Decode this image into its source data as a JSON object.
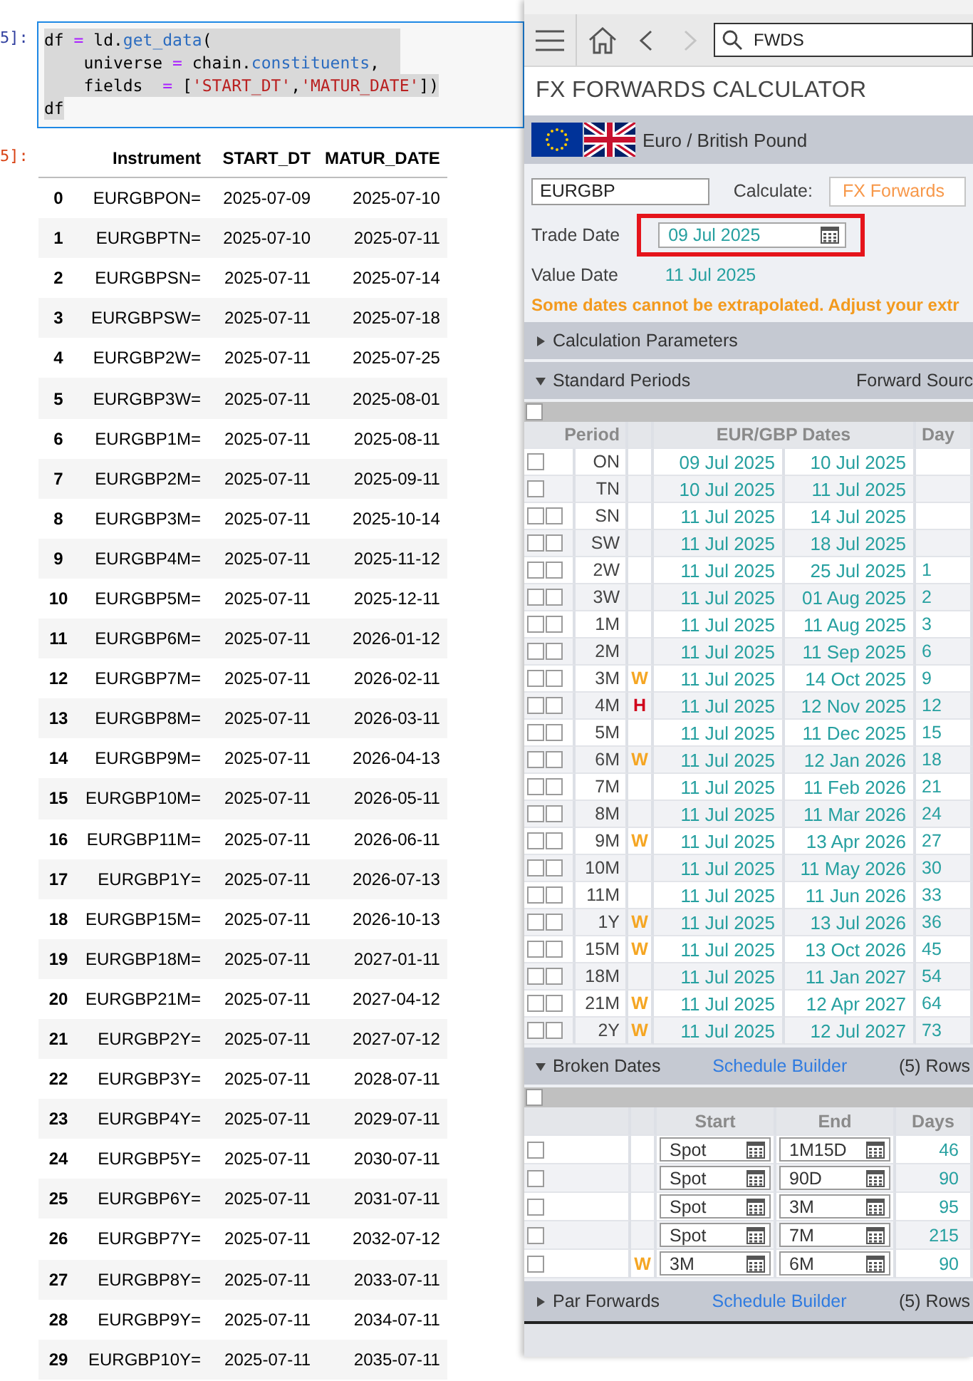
{
  "notebook": {
    "input_prompt": "5]:",
    "code_lines": [
      [
        {
          "text": "df ",
          "kind": "name"
        },
        {
          "text": "=",
          "kind": "op"
        },
        {
          "text": " ld.",
          "kind": "name"
        },
        {
          "text": "get_data",
          "kind": "attr"
        },
        {
          "text": "(",
          "kind": "name"
        }
      ],
      [
        {
          "text": "    universe ",
          "kind": "name"
        },
        {
          "text": "=",
          "kind": "op"
        },
        {
          "text": " chain.",
          "kind": "name"
        },
        {
          "text": "constituents",
          "kind": "attr"
        },
        {
          "text": ",",
          "kind": "name"
        }
      ],
      [
        {
          "text": "    fields  ",
          "kind": "name"
        },
        {
          "text": "=",
          "kind": "op"
        },
        {
          "text": " [",
          "kind": "name"
        },
        {
          "text": "'START_DT'",
          "kind": "str"
        },
        {
          "text": ",",
          "kind": "name"
        },
        {
          "text": "'MATUR_DATE'",
          "kind": "str"
        },
        {
          "text": "])",
          "kind": "name"
        }
      ],
      [
        {
          "text": "df",
          "kind": "name"
        }
      ]
    ],
    "output_prompt": "5]:",
    "table": {
      "columns": [
        "Instrument",
        "START_DT",
        "MATUR_DATE"
      ],
      "rows": [
        {
          "index": "0",
          "cells": [
            "EURGBPON=",
            "2025-07-09",
            "2025-07-10"
          ]
        },
        {
          "index": "1",
          "cells": [
            "EURGBPTN=",
            "2025-07-10",
            "2025-07-11"
          ]
        },
        {
          "index": "2",
          "cells": [
            "EURGBPSN=",
            "2025-07-11",
            "2025-07-14"
          ]
        },
        {
          "index": "3",
          "cells": [
            "EURGBPSW=",
            "2025-07-11",
            "2025-07-18"
          ]
        },
        {
          "index": "4",
          "cells": [
            "EURGBP2W=",
            "2025-07-11",
            "2025-07-25"
          ]
        },
        {
          "index": "5",
          "cells": [
            "EURGBP3W=",
            "2025-07-11",
            "2025-08-01"
          ]
        },
        {
          "index": "6",
          "cells": [
            "EURGBP1M=",
            "2025-07-11",
            "2025-08-11"
          ]
        },
        {
          "index": "7",
          "cells": [
            "EURGBP2M=",
            "2025-07-11",
            "2025-09-11"
          ]
        },
        {
          "index": "8",
          "cells": [
            "EURGBP3M=",
            "2025-07-11",
            "2025-10-14"
          ]
        },
        {
          "index": "9",
          "cells": [
            "EURGBP4M=",
            "2025-07-11",
            "2025-11-12"
          ]
        },
        {
          "index": "10",
          "cells": [
            "EURGBP5M=",
            "2025-07-11",
            "2025-12-11"
          ]
        },
        {
          "index": "11",
          "cells": [
            "EURGBP6M=",
            "2025-07-11",
            "2026-01-12"
          ]
        },
        {
          "index": "12",
          "cells": [
            "EURGBP7M=",
            "2025-07-11",
            "2026-02-11"
          ]
        },
        {
          "index": "13",
          "cells": [
            "EURGBP8M=",
            "2025-07-11",
            "2026-03-11"
          ]
        },
        {
          "index": "14",
          "cells": [
            "EURGBP9M=",
            "2025-07-11",
            "2026-04-13"
          ]
        },
        {
          "index": "15",
          "cells": [
            "EURGBP10M=",
            "2025-07-11",
            "2026-05-11"
          ]
        },
        {
          "index": "16",
          "cells": [
            "EURGBP11M=",
            "2025-07-11",
            "2026-06-11"
          ]
        },
        {
          "index": "17",
          "cells": [
            "EURGBP1Y=",
            "2025-07-11",
            "2026-07-13"
          ]
        },
        {
          "index": "18",
          "cells": [
            "EURGBP15M=",
            "2025-07-11",
            "2026-10-13"
          ]
        },
        {
          "index": "19",
          "cells": [
            "EURGBP18M=",
            "2025-07-11",
            "2027-01-11"
          ]
        },
        {
          "index": "20",
          "cells": [
            "EURGBP21M=",
            "2025-07-11",
            "2027-04-12"
          ]
        },
        {
          "index": "21",
          "cells": [
            "EURGBP2Y=",
            "2025-07-11",
            "2027-07-12"
          ]
        },
        {
          "index": "22",
          "cells": [
            "EURGBP3Y=",
            "2025-07-11",
            "2028-07-11"
          ]
        },
        {
          "index": "23",
          "cells": [
            "EURGBP4Y=",
            "2025-07-11",
            "2029-07-11"
          ]
        },
        {
          "index": "24",
          "cells": [
            "EURGBP5Y=",
            "2025-07-11",
            "2030-07-11"
          ]
        },
        {
          "index": "25",
          "cells": [
            "EURGBP6Y=",
            "2025-07-11",
            "2031-07-11"
          ]
        },
        {
          "index": "26",
          "cells": [
            "EURGBP7Y=",
            "2025-07-11",
            "2032-07-12"
          ]
        },
        {
          "index": "27",
          "cells": [
            "EURGBP8Y=",
            "2025-07-11",
            "2033-07-11"
          ]
        },
        {
          "index": "28",
          "cells": [
            "EURGBP9Y=",
            "2025-07-11",
            "2034-07-11"
          ]
        },
        {
          "index": "29",
          "cells": [
            "EURGBP10Y=",
            "2025-07-11",
            "2035-07-11"
          ]
        }
      ]
    }
  },
  "calculator": {
    "toolbar": {
      "back_button": {
        "disabled": false
      },
      "forward_button": {
        "disabled": true
      },
      "search": {
        "value": "FWDS"
      }
    },
    "title": "FX FORWARDS CALCULATOR",
    "currency_pair": "Euro / British Pound",
    "ric_field": {
      "value": "EURGBP"
    },
    "calculate_label": "Calculate:",
    "calculate_value": "FX Forwards",
    "trade_date": {
      "label": "Trade Date",
      "value": "09 Jul 2025",
      "highlighted": true
    },
    "value_date": {
      "label": "Value Date",
      "value": "11 Jul 2025"
    },
    "warning": "Some dates cannot be extrapolated. Adjust your extr",
    "calculation_parameters": {
      "title": "Calculation Parameters",
      "expanded": false
    },
    "standard_periods": {
      "title": "Standard Periods",
      "expanded": true,
      "source_label": "Forward Sourc",
      "select_all": {
        "checked": false
      },
      "columns": [
        "Period",
        "EUR/GBP Dates",
        "Day"
      ],
      "rows": [
        {
          "kind": "plain",
          "period": "ON",
          "checks": [
            false
          ],
          "start": "09 Jul 2025",
          "end": "10 Jul 2025"
        },
        {
          "kind": "plain",
          "period": "TN",
          "checks": [
            false
          ],
          "start": "10 Jul 2025",
          "end": "11 Jul 2025"
        },
        {
          "kind": "plain",
          "period": "SN",
          "checks": [
            false,
            false
          ],
          "start": "11 Jul 2025",
          "end": "14 Jul 2025"
        },
        {
          "kind": "plain",
          "period": "SW",
          "checks": [
            false,
            false
          ],
          "start": "11 Jul 2025",
          "end": "18 Jul 2025"
        },
        {
          "kind": "plain",
          "period": "2W",
          "checks": [
            false,
            false
          ],
          "start": "11 Jul 2025",
          "end": "25 Jul 2025",
          "days": "1"
        },
        {
          "kind": "plain",
          "period": "3W",
          "checks": [
            false,
            false
          ],
          "start": "11 Jul 2025",
          "end": "01 Aug 2025",
          "days": "2"
        },
        {
          "kind": "plain",
          "period": "1M",
          "checks": [
            false,
            false
          ],
          "start": "11 Jul 2025",
          "end": "11 Aug 2025",
          "days": "3"
        },
        {
          "kind": "plain",
          "period": "2M",
          "checks": [
            false,
            false
          ],
          "start": "11 Jul 2025",
          "end": "11 Sep 2025",
          "days": "6"
        },
        {
          "kind": "warning",
          "period": "3M",
          "checks": [
            false,
            false
          ],
          "flag": "W",
          "start": "11 Jul 2025",
          "end": "14 Oct 2025",
          "days": "9"
        },
        {
          "kind": "holiday",
          "period": "4M",
          "checks": [
            false,
            false
          ],
          "flag": "H",
          "start": "11 Jul 2025",
          "end": "12 Nov 2025",
          "days": "12"
        },
        {
          "kind": "plain",
          "period": "5M",
          "checks": [
            false,
            false
          ],
          "start": "11 Jul 2025",
          "end": "11 Dec 2025",
          "days": "15"
        },
        {
          "kind": "warning",
          "period": "6M",
          "checks": [
            false,
            false
          ],
          "flag": "W",
          "start": "11 Jul 2025",
          "end": "12 Jan 2026",
          "days": "18"
        },
        {
          "kind": "plain",
          "period": "7M",
          "checks": [
            false,
            false
          ],
          "start": "11 Jul 2025",
          "end": "11 Feb 2026",
          "days": "21"
        },
        {
          "kind": "plain",
          "period": "8M",
          "checks": [
            false,
            false
          ],
          "start": "11 Jul 2025",
          "end": "11 Mar 2026",
          "days": "24"
        },
        {
          "kind": "warning",
          "period": "9M",
          "checks": [
            false,
            false
          ],
          "flag": "W",
          "start": "11 Jul 2025",
          "end": "13 Apr 2026",
          "days": "27"
        },
        {
          "kind": "plain",
          "period": "10M",
          "checks": [
            false,
            false
          ],
          "start": "11 Jul 2025",
          "end": "11 May 2026",
          "days": "30"
        },
        {
          "kind": "plain",
          "period": "11M",
          "checks": [
            false,
            false
          ],
          "start": "11 Jul 2025",
          "end": "11 Jun 2026",
          "days": "33"
        },
        {
          "kind": "warning",
          "period": "1Y",
          "checks": [
            false,
            false
          ],
          "flag": "W",
          "start": "11 Jul 2025",
          "end": "13 Jul 2026",
          "days": "36"
        },
        {
          "kind": "warning",
          "period": "15M",
          "checks": [
            false,
            false
          ],
          "flag": "W",
          "start": "11 Jul 2025",
          "end": "13 Oct 2026",
          "days": "45"
        },
        {
          "kind": "plain",
          "period": "18M",
          "checks": [
            false,
            false
          ],
          "start": "11 Jul 2025",
          "end": "11 Jan 2027",
          "days": "54"
        },
        {
          "kind": "warning",
          "period": "21M",
          "checks": [
            false,
            false
          ],
          "flag": "W",
          "start": "11 Jul 2025",
          "end": "12 Apr 2027",
          "days": "64"
        },
        {
          "kind": "warning",
          "period": "2Y",
          "checks": [
            false,
            false
          ],
          "flag": "W",
          "start": "11 Jul 2025",
          "end": "12 Jul 2027",
          "days": "73"
        }
      ]
    },
    "broken_dates": {
      "title": "Broken Dates",
      "expanded": true,
      "link": "Schedule Builder",
      "count": "(5) Rows",
      "select_all": {
        "checked": false
      },
      "columns": [
        "Start",
        "End",
        "Days"
      ],
      "rows": [
        {
          "kind": "plain",
          "checked": false,
          "start": "Spot",
          "end": "1M15D",
          "days": "46"
        },
        {
          "kind": "plain",
          "checked": false,
          "start": "Spot",
          "end": "90D",
          "days": "90"
        },
        {
          "kind": "plain",
          "checked": false,
          "start": "Spot",
          "end": "3M",
          "days": "95"
        },
        {
          "kind": "plain",
          "checked": false,
          "start": "Spot",
          "end": "7M",
          "days": "215"
        },
        {
          "kind": "warning",
          "checked": false,
          "flag": "W",
          "start": "3M",
          "end": "6M",
          "days": "90"
        }
      ]
    },
    "par_forwards": {
      "title": "Par Forwards",
      "expanded": false,
      "link": "Schedule Builder",
      "count": "(5) Rows"
    }
  }
}
